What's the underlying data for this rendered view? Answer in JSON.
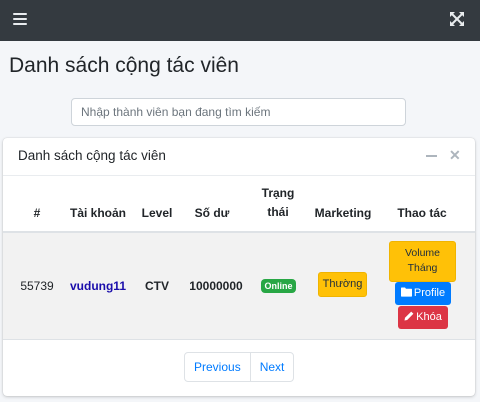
{
  "page": {
    "title": "Danh sách cộng tác viên",
    "search": {
      "placeholder": "Nhập thành viên bạn đang tìm kiếm",
      "value": ""
    }
  },
  "card": {
    "title": "Danh sách cộng tác viên",
    "tools": {
      "collapse_icon": "minus-icon",
      "remove_icon": "close-icon"
    }
  },
  "table": {
    "headers": {
      "index": "#",
      "account": "Tài khoản",
      "level": "Level",
      "balance": "Số dư",
      "status_line1": "Trạng",
      "status_line2": "thái",
      "marketing": "Marketing",
      "actions": "Thao tác"
    },
    "rows": [
      {
        "id": "55739",
        "account": "vudung11",
        "level": "CTV",
        "balance": "10000000",
        "status": "Online",
        "marketing": "Thường",
        "actions": {
          "volume_line1": "Volume",
          "volume_line2": "Tháng",
          "profile": "Profile",
          "lock": "Khóa"
        }
      }
    ]
  },
  "pagination": {
    "previous": "Previous",
    "next": "Next"
  },
  "icons": {
    "menu": "hamburger-menu-icon",
    "fullscreen": "expand-arrows-icon",
    "folder": "folder-icon",
    "pencil": "pencil-icon"
  },
  "colors": {
    "topbar": "#343a40",
    "online": "#28a745",
    "warning": "#ffc107",
    "primary": "#007bff",
    "danger": "#dc3545",
    "link": "#1a0dab"
  }
}
